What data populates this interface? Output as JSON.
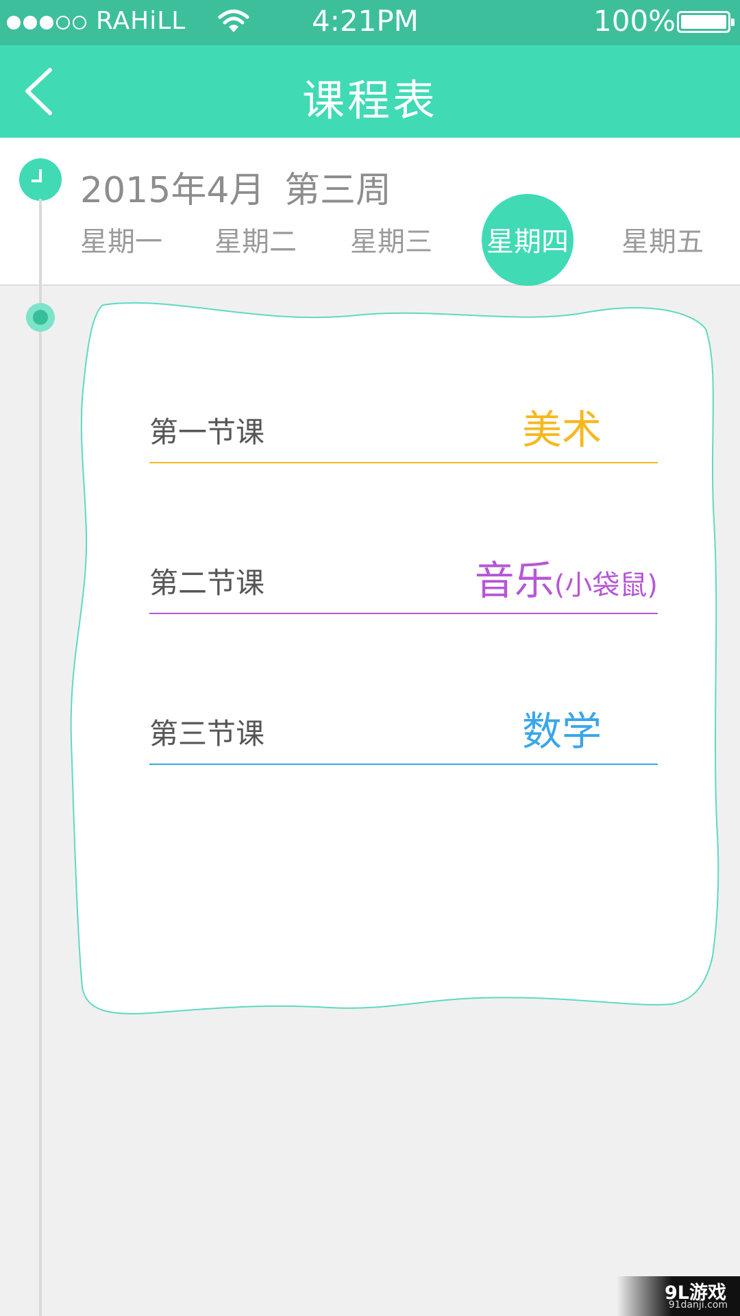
{
  "status_bar": {
    "carrier": "RAHiLL",
    "time": "4:21PM",
    "battery": "100%",
    "signal_bars_filled": 3,
    "signal_bars_total": 5
  },
  "nav": {
    "title": "课程表",
    "back_icon": "chevron-left-icon"
  },
  "header": {
    "month": "2015年4月",
    "week": "第三周",
    "days": [
      "星期一",
      "星期二",
      "星期三",
      "星期四",
      "星期五"
    ],
    "selected_day": "星期四"
  },
  "lessons": [
    {
      "label": "第一节课",
      "subject": "美术",
      "note": "",
      "color": "#f7b81e"
    },
    {
      "label": "第二节课",
      "subject": "音乐",
      "note": "(小袋鼠)",
      "color": "#b557d6"
    },
    {
      "label": "第三节课",
      "subject": "数学",
      "note": "",
      "color": "#3aa6e8"
    }
  ],
  "colors": {
    "accent": "#40dab5",
    "status_bar": "#3dbf9c",
    "background": "#f0f0f0",
    "card_border": "#5fd9bf"
  },
  "watermark": {
    "main": "9L游戏",
    "sub": "91danji.com"
  }
}
